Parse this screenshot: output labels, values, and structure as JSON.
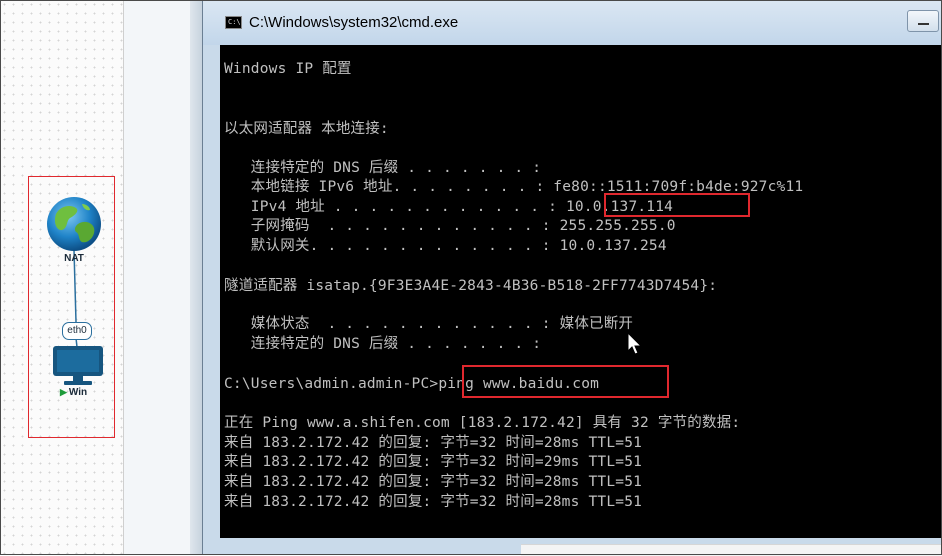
{
  "topology": {
    "nat_node_label": "NAT",
    "interface_label": "eth0",
    "win_node_label": "Win"
  },
  "window": {
    "title": "C:\\Windows\\system32\\cmd.exe",
    "icon_text": "C:\\"
  },
  "console_lines": [
    "Windows IP 配置",
    "",
    "",
    "以太网适配器 本地连接:",
    "",
    "   连接特定的 DNS 后缀 . . . . . . . :",
    "   本地链接 IPv6 地址. . . . . . . . : fe80::1511:709f:b4de:927c%11",
    "   IPv4 地址 . . . . . . . . . . . . : 10.0.137.114",
    "   子网掩码  . . . . . . . . . . . . : 255.255.255.0",
    "   默认网关. . . . . . . . . . . . . : 10.0.137.254",
    "",
    "隧道适配器 isatap.{9F3E3A4E-2843-4B36-B518-2FF7743D7454}:",
    "",
    "   媒体状态  . . . . . . . . . . . . : 媒体已断开",
    "   连接特定的 DNS 后缀 . . . . . . . :",
    "",
    "C:\\Users\\admin.admin-PC>ping www.baidu.com",
    "",
    "正在 Ping www.a.shifen.com [183.2.172.42] 具有 32 字节的数据:",
    "来自 183.2.172.42 的回复: 字节=32 时间=28ms TTL=51",
    "来自 183.2.172.42 的回复: 字节=32 时间=29ms TTL=51",
    "来自 183.2.172.42 的回复: 字节=32 时间=28ms TTL=51",
    "来自 183.2.172.42 的回复: 字节=32 时间=28ms TTL=51"
  ],
  "highlights": {
    "ipv4_address": "10.0.137.114",
    "ping_command": "ping www.baidu.com"
  },
  "colors": {
    "highlight_border": "#e0282e",
    "console_text": "#c0c0c0",
    "console_background": "#000000"
  }
}
